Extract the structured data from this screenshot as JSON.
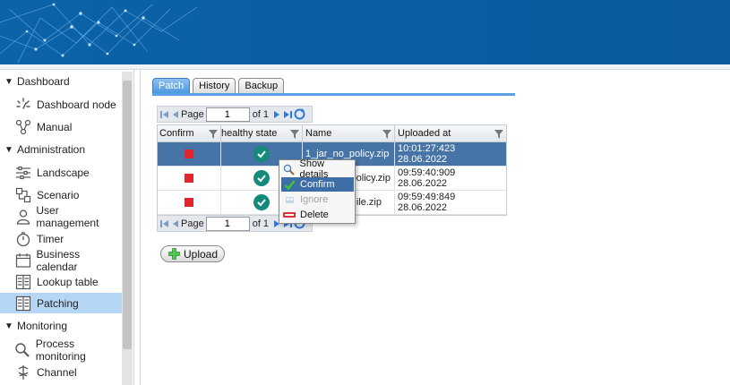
{
  "sidebar": {
    "sections": [
      {
        "label": "Dashboard"
      },
      {
        "label": "Administration"
      },
      {
        "label": "Monitoring"
      }
    ],
    "items": [
      {
        "label": "Dashboard node",
        "icon": "dashboard-node-icon"
      },
      {
        "label": "Manual",
        "icon": "manual-icon"
      },
      {
        "label": "Landscape",
        "icon": "landscape-icon"
      },
      {
        "label": "Scenario",
        "icon": "scenario-icon"
      },
      {
        "label": "User management",
        "icon": "user-icon"
      },
      {
        "label": "Timer",
        "icon": "timer-icon"
      },
      {
        "label": "Business calendar",
        "icon": "calendar-icon"
      },
      {
        "label": "Lookup table",
        "icon": "table-icon"
      },
      {
        "label": "Patching",
        "icon": "table-icon",
        "active": true
      },
      {
        "label": "Process monitoring",
        "icon": "magnifier-icon"
      },
      {
        "label": "Channel",
        "icon": "channel-icon"
      }
    ]
  },
  "tabs": [
    {
      "label": "Patch",
      "active": true
    },
    {
      "label": "History"
    },
    {
      "label": "Backup"
    }
  ],
  "pager": {
    "page_label": "Page",
    "page_value": "1",
    "of_label": "of 1"
  },
  "grid": {
    "columns": [
      "Confirm",
      "healthy state",
      "Name",
      "Uploaded at"
    ],
    "rows": [
      {
        "name": "1_jar_no_policy.zip",
        "uploaded": "10:01:27:423 28.06.2022",
        "selected": true
      },
      {
        "name": "policy.zip",
        "uploaded": "09:59:40:909 28.06.2022"
      },
      {
        "name": "ile.zip",
        "uploaded": "09:59:49:849 28.06.2022"
      }
    ]
  },
  "context_menu": {
    "items": [
      {
        "label": "Show details",
        "icon": "magnifier-icon"
      },
      {
        "label": "Confirm",
        "icon": "checkmark-icon",
        "highlighted": true
      },
      {
        "label": "Ignore",
        "icon": "ignore-icon",
        "disabled": true
      },
      {
        "label": "Delete",
        "icon": "delete-icon"
      }
    ]
  },
  "upload": {
    "label": "Upload"
  },
  "colors": {
    "banner": "#0b5ea3",
    "active_nav": "#b6d6f5",
    "selected_row": "#4774a6",
    "status_red": "#e0262d",
    "status_ok": "#138a7a"
  }
}
